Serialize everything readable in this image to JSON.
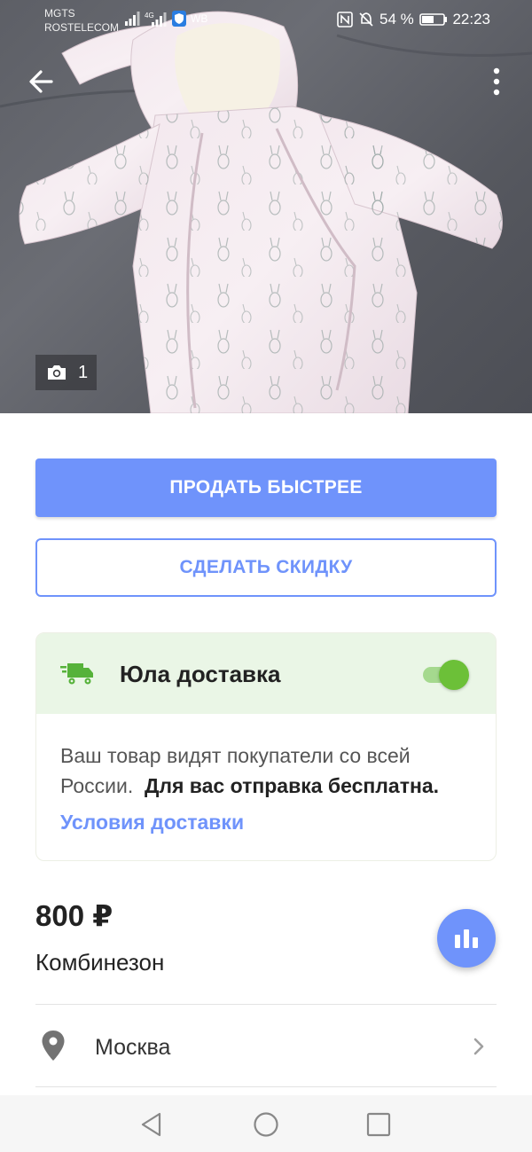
{
  "status_bar": {
    "carrier_line1": "MGTS",
    "carrier_line2": "ROSTELECOM",
    "network_label": "4G",
    "vpn_label": "WB",
    "battery_percent": "54 %",
    "time": "22:23"
  },
  "photo": {
    "count": "1",
    "icons": [
      "back-arrow-icon",
      "more-vert-icon",
      "camera-icon"
    ]
  },
  "actions": {
    "sell_faster_label": "ПРОДАТЬ БЫСТРЕЕ",
    "discount_label": "СДЕЛАТЬ СКИДКУ"
  },
  "delivery": {
    "title": "Юла доставка",
    "enabled": true,
    "text_plain": "Ваш товар видят покупатели со всей России.",
    "text_bold": "Для вас отправка бесплатна.",
    "link": "Условия доставки"
  },
  "listing": {
    "price": "800 ₽",
    "title": "Комбинезон",
    "location": "Москва"
  },
  "colors": {
    "accent": "#6f93fb",
    "delivery_bg": "#eaf6e6",
    "toggle_on": "#6cc038"
  }
}
